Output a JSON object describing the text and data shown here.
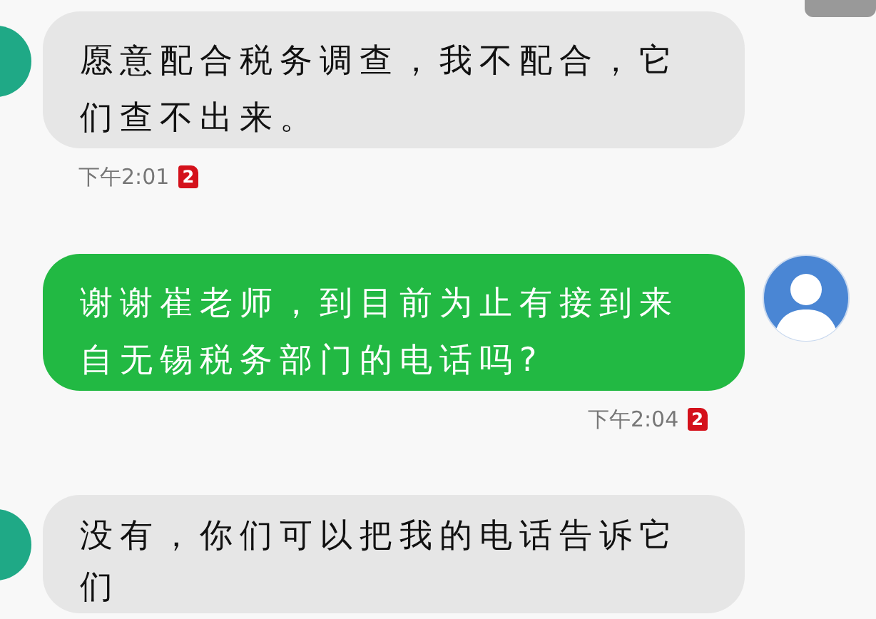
{
  "messages": [
    {
      "kind": "incoming",
      "text": "愿意配合税务调查，我不配合，它们查不出来。",
      "time": "下午2:01",
      "sim": "2"
    },
    {
      "kind": "outgoing",
      "text": "谢谢崔老师，到目前为止有接到来自无锡税务部门的电话吗?",
      "time": "下午2:04",
      "sim": "2"
    },
    {
      "kind": "incoming",
      "text": "没有，你们可以把我的电话告诉它们"
    }
  ]
}
